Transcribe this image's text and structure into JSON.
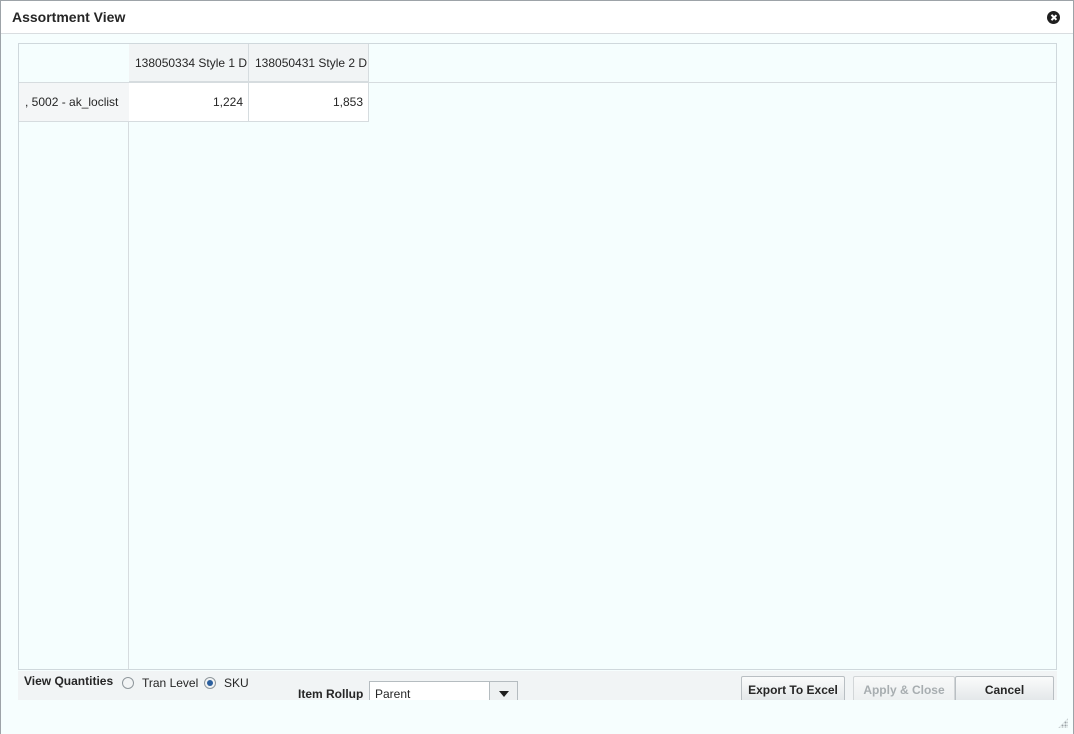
{
  "dialog": {
    "title": "Assortment View"
  },
  "grid": {
    "columns": [
      "138050334 Style 1 D",
      "138050431 Style 2 D"
    ],
    "rows": [
      {
        "label": ", 5002 - ak_loclist",
        "values": [
          "1,224",
          "1,853"
        ]
      }
    ]
  },
  "footer": {
    "view_quantities_label": "View Quantities",
    "options": [
      {
        "label": "Tran Level",
        "checked": false
      },
      {
        "label": "SKU",
        "checked": true
      }
    ],
    "item_rollup_label": "Item Rollup",
    "item_rollup_value": "Parent",
    "buttons": {
      "export": "Export To Excel",
      "apply_close": "Apply & Close",
      "cancel": "Cancel"
    }
  },
  "icons": {
    "close": "close-icon",
    "dropdown": "chevron-down-icon",
    "resize": "resize-grip-icon"
  }
}
